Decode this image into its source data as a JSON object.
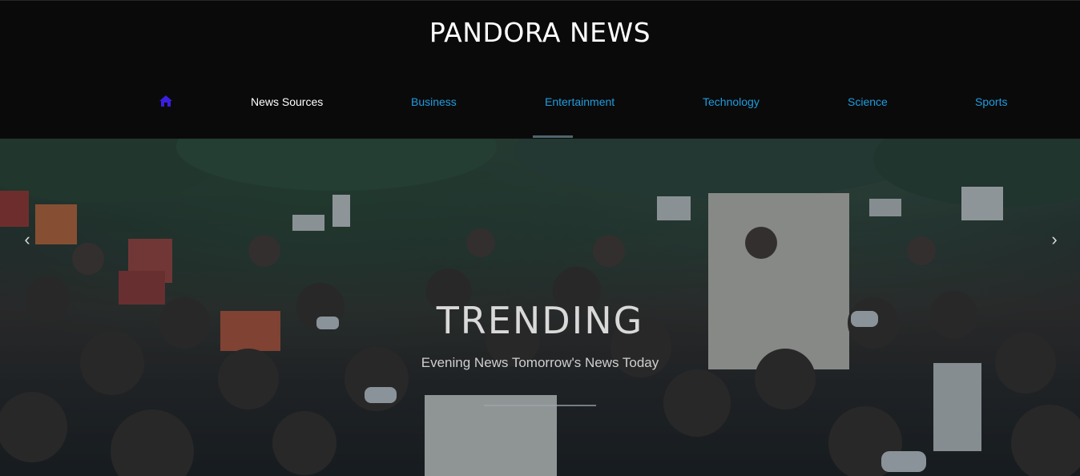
{
  "header": {
    "brand": "PANDORA NEWS"
  },
  "nav": {
    "home_icon": "home-icon",
    "items": [
      {
        "label": "News Sources",
        "active": true
      },
      {
        "label": "Business"
      },
      {
        "label": "Entertainment"
      },
      {
        "label": "Technology"
      },
      {
        "label": "Science"
      },
      {
        "label": "Sports"
      }
    ]
  },
  "hero": {
    "title": "TRENDING",
    "subtitle": "Evening News Tomorrow's News Today",
    "prev_icon": "chevron-left-icon",
    "next_icon": "chevron-right-icon"
  },
  "colors": {
    "header_bg": "#0b0a0a",
    "nav_link": "#1e9de0",
    "home_icon": "#3a1fe0"
  }
}
